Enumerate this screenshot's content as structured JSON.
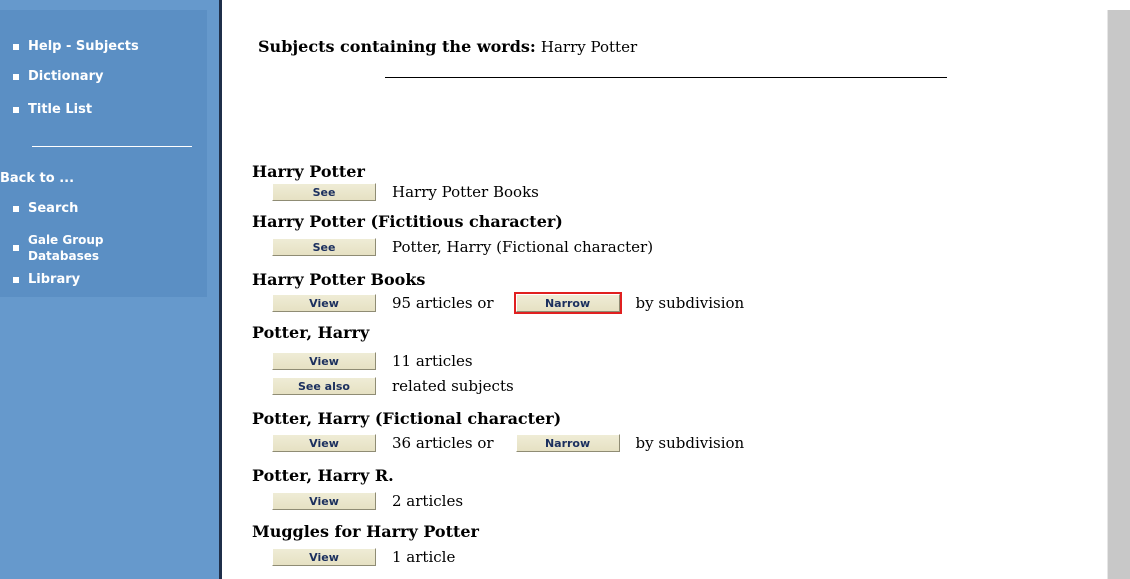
{
  "sidebar": {
    "nav": [
      {
        "label": "Help - Subjects"
      },
      {
        "label": "Dictionary"
      },
      {
        "label": "Title List"
      }
    ],
    "back_to": "Back to ...",
    "back_items": [
      {
        "label": "Search"
      },
      {
        "label": "Gale Group Databases"
      },
      {
        "label": "Library"
      }
    ]
  },
  "main": {
    "heading_label": "Subjects containing the words:",
    "query": "Harry Potter",
    "entries": [
      {
        "title": "Harry Potter",
        "lines": [
          {
            "button": "See",
            "text": "Harry Potter Books"
          }
        ]
      },
      {
        "title": "Harry Potter (Fictitious character)",
        "lines": [
          {
            "button": "See",
            "text": "Potter, Harry (Fictional character)"
          }
        ]
      },
      {
        "title": "Harry Potter Books",
        "lines": [
          {
            "button": "View",
            "text": "95 articles or",
            "button2": "Narrow",
            "text2": "by subdivision"
          }
        ]
      },
      {
        "title": "Potter, Harry",
        "lines": [
          {
            "button": "View",
            "text": "11 articles"
          },
          {
            "button": "See also",
            "text": "related subjects"
          }
        ]
      },
      {
        "title": "Potter, Harry (Fictional character)",
        "lines": [
          {
            "button": "View",
            "text": "36 articles or",
            "button2": "Narrow",
            "text2": "by subdivision"
          }
        ]
      },
      {
        "title": "Potter, Harry R.",
        "lines": [
          {
            "button": "View",
            "text": "2 articles"
          }
        ]
      },
      {
        "title": "Muggles for Harry Potter",
        "lines": [
          {
            "button": "View",
            "text": "1 article"
          }
        ]
      }
    ]
  },
  "colors": {
    "sidebar_bg": "#6699cc",
    "button_bg": "#e6e1c3",
    "button_text": "#1b2f5e",
    "highlight": "#e02020"
  }
}
